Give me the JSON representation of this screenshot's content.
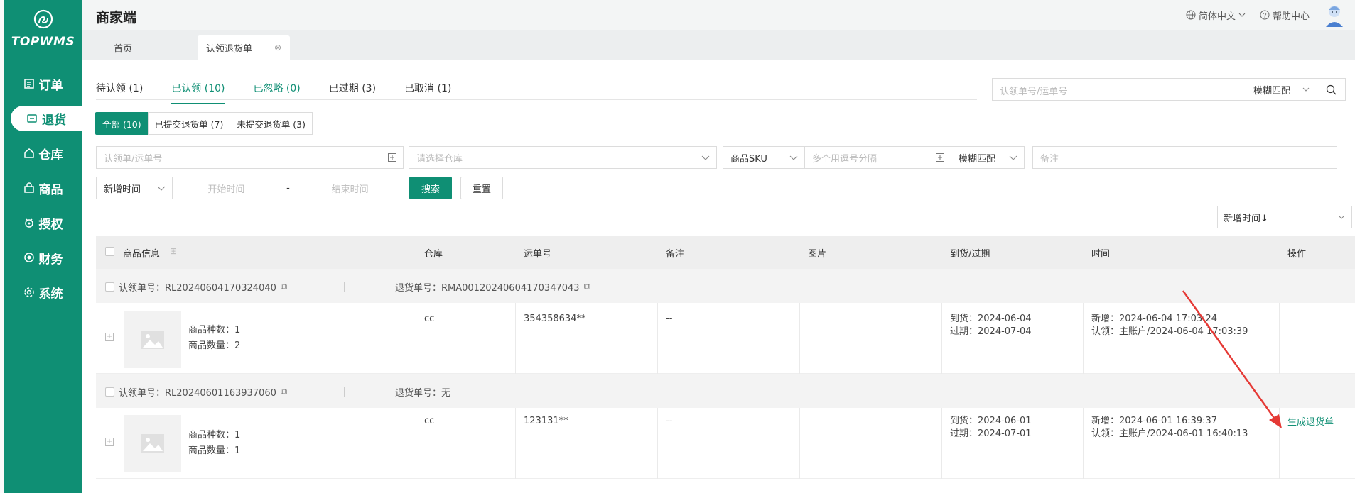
{
  "app": {
    "logo_text": "TOPWMS",
    "title": "商家端"
  },
  "sidebar": {
    "items": [
      {
        "label": "订单",
        "icon": "list-icon"
      },
      {
        "label": "退货",
        "icon": "return-icon"
      },
      {
        "label": "仓库",
        "icon": "warehouse-icon"
      },
      {
        "label": "商品",
        "icon": "bag-icon"
      },
      {
        "label": "授权",
        "icon": "authorize-icon"
      },
      {
        "label": "财务",
        "icon": "finance-icon"
      },
      {
        "label": "系统",
        "icon": "gear-icon"
      }
    ],
    "active_index": 1
  },
  "header": {
    "language": "简体中文",
    "help": "帮助中心"
  },
  "tabs": {
    "home": "首页",
    "current": "认领退货单"
  },
  "status_tabs": [
    {
      "label": "待认领 (1)"
    },
    {
      "label": "已认领 (10)"
    },
    {
      "label": "已忽略 (0)"
    },
    {
      "label": "已过期 (3)"
    },
    {
      "label": "已取消 (1)"
    }
  ],
  "top_search": {
    "placeholder": "认领单号/运单号",
    "match": "模糊匹配"
  },
  "sub_tabs": [
    {
      "label": "全部 (10)"
    },
    {
      "label": "已提交退货单 (7)"
    },
    {
      "label": "未提交退货单 (3)"
    }
  ],
  "filters": {
    "claim_no_placeholder": "认领单/运单号",
    "warehouse_placeholder": "请选择仓库",
    "sku_select": "商品SKU",
    "sku_placeholder": "多个用逗号分隔",
    "sku_match": "模糊匹配",
    "remark_placeholder": "备注",
    "time_type": "新增时间",
    "start_placeholder": "开始时间",
    "range_sep": "-",
    "end_placeholder": "结束时间",
    "search_btn": "搜索",
    "reset_btn": "重置"
  },
  "sort": {
    "value": "新增时间↓"
  },
  "table": {
    "headers": {
      "product": "商品信息",
      "warehouse": "仓库",
      "tracking": "运单号",
      "remark": "备注",
      "image": "图片",
      "arrival": "到货/过期",
      "time": "时间",
      "action": "操作"
    },
    "groups": [
      {
        "claim_label": "认领单号：RL20240604170324040",
        "return_label": "退货单号：RMA0012024060417034704​3",
        "kinds": "商品种数：1",
        "qty": "商品数量：2",
        "warehouse": "cc",
        "tracking": "354358634**",
        "remark": "--",
        "arrival": "到货：2024-06-04",
        "expire": "过期：2024-07-04",
        "added": "新增：2024-06-04 17:03:24",
        "claimed": "认领：主账户/2024-06-04 17:03:39",
        "action": ""
      },
      {
        "claim_label": "认领单号：RL20240601163937060",
        "return_label": "退货单号：无",
        "kinds": "商品种数：1",
        "qty": "商品数量：1",
        "warehouse": "cc",
        "tracking": "123131**",
        "remark": "--",
        "arrival": "到货：2024-06-01",
        "expire": "过期：2024-07-01",
        "added": "新增：2024-06-01 16:39:37",
        "claimed": "认领：主账户/2024-06-01 16:40:13",
        "action": "生成退货单"
      }
    ]
  },
  "colors": {
    "brand": "#0f8f74",
    "annotation_arrow": "#e53935"
  }
}
